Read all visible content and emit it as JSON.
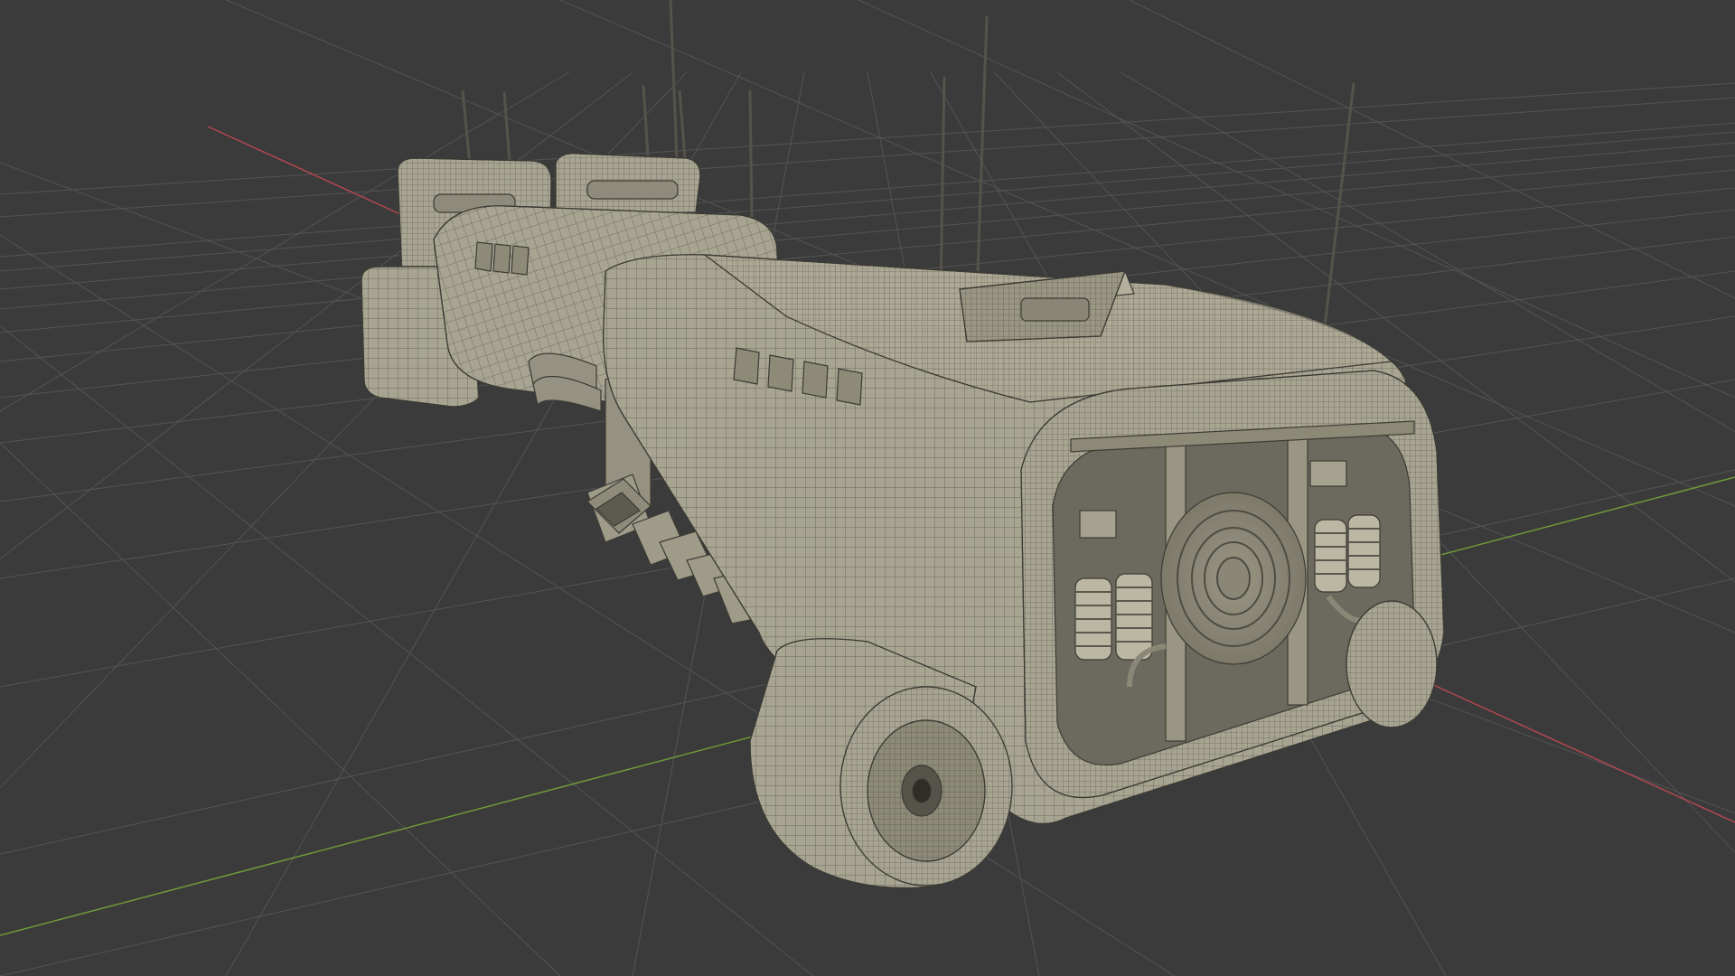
{
  "viewport": {
    "background_color": "#3b3b3b",
    "grid_color": "#545454",
    "x_axis_color": "#b0474f",
    "y_axis_color": "#6d9a3a",
    "model_color": "#a8a492",
    "wire_color": "#3c3b34"
  },
  "scene": {
    "object": "sci-fi-hover-vehicle",
    "display_mode": "wireframe-overlay",
    "parts": [
      "main-hull",
      "rear-engine-bay",
      "rear-thruster-left",
      "rear-thruster-right",
      "cockpit-module",
      "roof-sensor-box",
      "side-exhaust-pipes",
      "antennas"
    ]
  }
}
